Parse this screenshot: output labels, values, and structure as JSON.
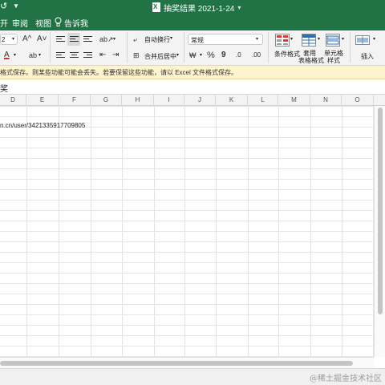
{
  "title_bar": {
    "undo_glyph": "↺",
    "more_glyph": "▼",
    "file_title": "抽奖结果 2021-1-24",
    "title_chevron": "▾"
  },
  "tabs": [
    {
      "label": "开"
    },
    {
      "label": "审阅"
    },
    {
      "label": "视图"
    },
    {
      "label": "告诉我"
    }
  ],
  "ribbon": {
    "font_size": "2",
    "font_color_accent": "#d32f2f",
    "wrap_text_label": "自动换行",
    "merge_center_label": "合并后居中",
    "number_format": "常规",
    "conditional_format_label": "条件格式",
    "table_format_line1": "套用",
    "table_format_line2": "表格格式",
    "cell_style_line1": "单元格",
    "cell_style_line2": "样式",
    "insert_label": "插入",
    "percent_glyph": "%",
    "comma_glyph": "9",
    "grow_font_glyph": "A^",
    "shrink_font_glyph": "A˅",
    "font_color_glyph": "A",
    "currency_glyph": "₩",
    "dropdown_glyph": "▾"
  },
  "info_bar": {
    "message": "格式保存。则某些功能可能会丢失。若要保留这些功能，请以 Excel 文件格式保存。"
  },
  "formula_bar": {
    "value": "奖"
  },
  "columns": [
    "D",
    "E",
    "F",
    "G",
    "H",
    "I",
    "J",
    "K",
    "L",
    "M",
    "N",
    "O"
  ],
  "grid": {
    "cell_value": "n.cn/user/3421335917709805"
  },
  "watermark": "@稀土掘金技术社区",
  "colors": {
    "brand": "#217346",
    "infobar_bg": "#fdf3cd"
  }
}
